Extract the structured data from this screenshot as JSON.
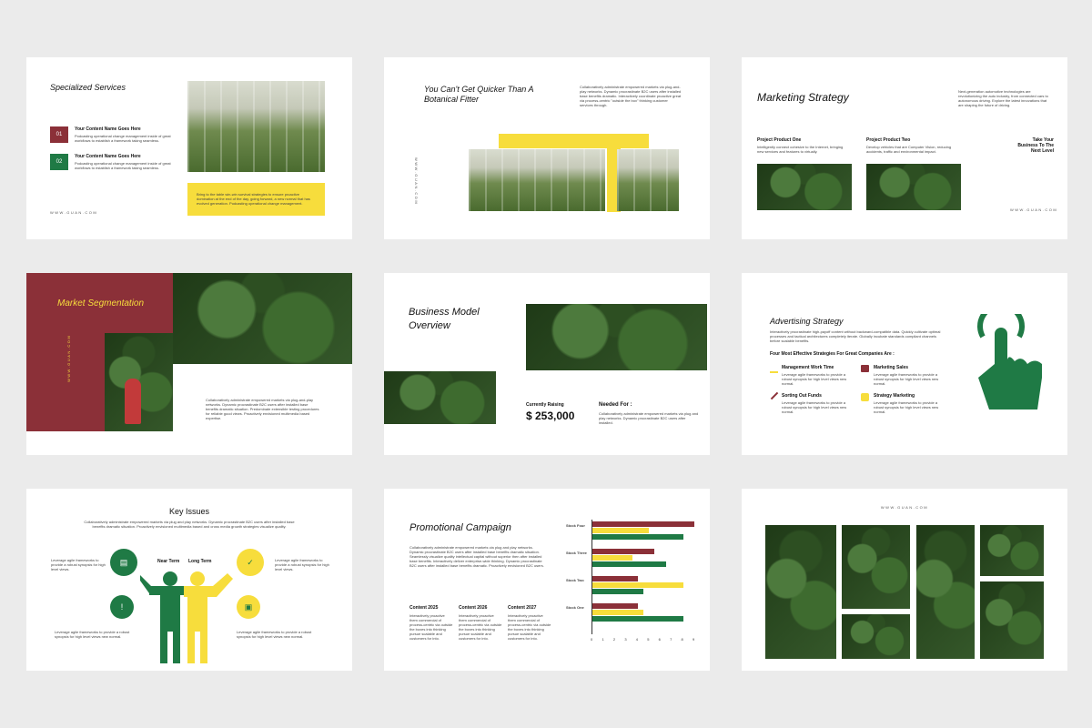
{
  "s1": {
    "title": "Specialized Services",
    "items": [
      {
        "num": "01",
        "heading": "Your Content Name Goes Here",
        "text": "Podcasting operational change management inside of great workflows to establish a framework taking seamless."
      },
      {
        "num": "02",
        "heading": "Your Content Name Goes Here",
        "text": "Podcasting operational change management inside of great workflows to establish a framework taking seamless."
      }
    ],
    "yellow_text": "Bring to the table win-win survival strategies to ensure proactive domination at the end of the day, going forward, a new normal that has evolved generation. Podcasting operational change management.",
    "web": "WWW.GUAN.COM"
  },
  "s2": {
    "title": "You Can't Get Quicker Than A Botanical Fitter",
    "body": "Collaboratively administrate empowered markets via plug-and-play networks. Dynamic procrastinate B2C users after installed base benefits dramatic. Interactively coordinate proactive great via process-centric \"outside the box\" thinking customer services through.",
    "web": "WWW.GUAN.COM"
  },
  "s3": {
    "title": "Marketing Strategy",
    "body": "Next-generation automotive technologies are revolutionizing the auto industry, from connected cars to autonomous driving. Explore the latest innovations that are shaping the future of driving.",
    "p1_title": "Project Product One",
    "p1_text": "Intelligently connect cohesive to the Internet, bringing new services and features to virtually.",
    "p2_title": "Project Product Two",
    "p2_text": "Develop vehicles that are Computer Vision, reducing accidents, traffic and environmental impact.",
    "cta": "Take Your Business To The Next Level",
    "web": "WWW.GUAN.COM"
  },
  "s4": {
    "title": "Market Segmentation",
    "web": "WWW.GUAN.COM",
    "body": "Collaboratively administrate empowered markets via plug-and-play networks. Dynamic procrastinate B2C users after installed base benefits dramatic situation. Predominate extensible testing procedures for reliable good views. Proactively envisioned multimedia based expertise."
  },
  "s5": {
    "title": "Business Model Overview",
    "raising_label": "Currently Raising",
    "raising_value": "$ 253,000",
    "needed_label": "Needed For :",
    "needed_text": "Collaboratively administrate empowered markets via plug and play networks. Dynamic procrastinate B2C users after installed."
  },
  "s6": {
    "title": "Advertising Strategy",
    "body": "Interactively procrastinate high-payoff content without backward-compatible data. Quickly cultivate optimal processes and tactical architectures completely iterate. Globally incubate standards compliant channels before scalable benefits.",
    "subtitle": "Four Most Effective Strategies For Great Companies Are :",
    "items": [
      {
        "title": "Management Work Time",
        "text": "Leverage agile frameworks to provide a robust synopsis for high level views new normal."
      },
      {
        "title": "Marketing Sales",
        "text": "Leverage agile frameworks to provide a robust synopsis for high level views new normal."
      },
      {
        "title": "Sorting Out Funds",
        "text": "Leverage agile frameworks to provide a robust synopsis for high level views new normal."
      },
      {
        "title": "Strategy Marketing",
        "text": "Leverage agile frameworks to provide a robust synopsis for high level views new normal."
      }
    ]
  },
  "s7": {
    "title": "Key Issues",
    "body": "Collaboratively administrate empowered markets via plug and play networks. Dynamic procrastinate B2C users after installed base benefits dramatic situation. Proactively envisioned multimedia based and cross media growth strategies visualize quality.",
    "near": "Near Term",
    "long": "Long Term",
    "tl": "Leverage agile frameworks to provide a robust synopsis for high level views.",
    "tr": "Leverage agile frameworks to provide a robust synopsis for high level views.",
    "bl": "Leverage agile frameworks to provide a robust synopsis for high level views new normal.",
    "br": "Leverage agile frameworks to provide a robust synopsis for high level views new normal."
  },
  "s8": {
    "title": "Promotional Campaign",
    "body": "Collaboratively administrate empowered markets via plug and play networks. Dynamic procrastinate B2C users after installed base benefits dramatic situation. Seamlessly visualize quality intellectual capital without superior then after installed base benefits. Interactively deliver enterprise-wide thinking. Dynamic procrastinate B2C users after installed base benefits dramatic. Proactively envisioned B2C users.",
    "cols": [
      {
        "title": "Content 2025",
        "text": "Interactively proactive them commercial of process-centric via outside the boxes into thinking pursue scalable and customers for into."
      },
      {
        "title": "Content 2026",
        "text": "Interactively proactive them commercial of process-centric via outside the boxes into thinking pursue scalable and customers for into."
      },
      {
        "title": "Content 2027",
        "text": "Interactively proactive them commercial of process-centric via outside the boxes into thinking pursue scalable and customers for into."
      }
    ]
  },
  "s9": {
    "web": "WWW.GUAN.COM"
  },
  "chart_data": {
    "type": "bar",
    "orientation": "horizontal",
    "categories": [
      "Stock Four",
      "Stock Three",
      "Stock Two",
      "Stock One"
    ],
    "series": [
      {
        "color": "#8b3038",
        "values": [
          9,
          5.5,
          4,
          4
        ]
      },
      {
        "color": "#f7dd3c",
        "values": [
          5,
          3.5,
          8,
          4.5
        ]
      },
      {
        "color": "#1f7a45",
        "values": [
          8,
          6.5,
          4.5,
          8
        ]
      }
    ],
    "xticks": [
      "0",
      "1",
      "2",
      "3",
      "4",
      "5",
      "6",
      "7",
      "8",
      "9"
    ],
    "xlim": [
      0,
      9
    ]
  },
  "colors": {
    "maroon": "#8b3038",
    "green": "#1f7a45",
    "yellow": "#f7dd3c"
  }
}
